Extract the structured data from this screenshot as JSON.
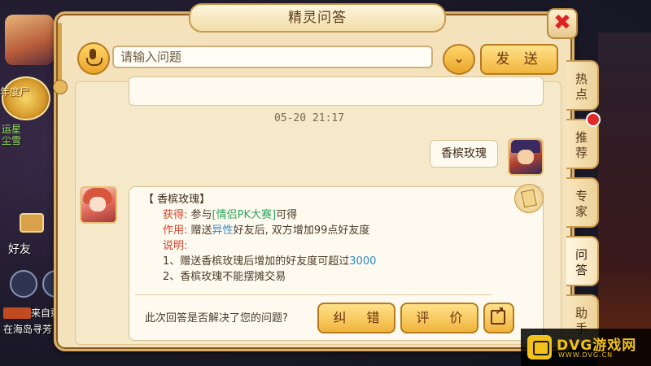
{
  "dialog": {
    "title": "精灵问答",
    "close_glyph": "✖"
  },
  "input": {
    "placeholder": "请输入问题",
    "send_label": "发 送",
    "dropdown_glyph": "⌄"
  },
  "chat": {
    "prev_answer_text": "",
    "timestamp": "05-20 21:17",
    "user_question": "香槟玫瑰",
    "answer": {
      "title": "【 香槟玫瑰】",
      "obtain_label": "获得:",
      "obtain_pre": "参与",
      "obtain_link": "[情侣PK大赛]",
      "obtain_post": "可得",
      "use_label": "作用:",
      "use_pre": "赠送",
      "use_highlight": "异性",
      "use_post": "好友后, 双方增加99点好友度",
      "note_label": "说明:",
      "note_1_pre": "1、赠送香槟玫瑰后增加的好友度可超过",
      "note_1_value": "3000",
      "note_2": "2、香槟玫瑰不能摆摊交易"
    },
    "feedback_question": "此次回答是否解决了您的问题?",
    "correct_label": "纠 错",
    "rate_label": "评 价"
  },
  "right_tabs": [
    {
      "label": "热点"
    },
    {
      "label": "推荐"
    },
    {
      "label": "专家"
    },
    {
      "label": "问答"
    },
    {
      "label": "助手"
    }
  ],
  "background": {
    "rank_text": "年度尸",
    "name_line1": "运星",
    "name_line2": "尘雪",
    "friend_label": "好友",
    "msg_line1": "来自剩",
    "msg_line2": "在海岛寻芳"
  },
  "watermark": {
    "brand": "DVG游戏网",
    "url": "WWW.DVG.CN"
  },
  "colors": {
    "accent_gold": "#f0b43c",
    "link_green": "#2aa35a",
    "highlight_blue": "#2a8ad0",
    "label_red": "#d2422a",
    "notification_red": "#e22a2a"
  },
  "icons": [
    "microphone-icon",
    "chevron-down-icon",
    "close-icon",
    "scroll-icon",
    "share-icon"
  ]
}
